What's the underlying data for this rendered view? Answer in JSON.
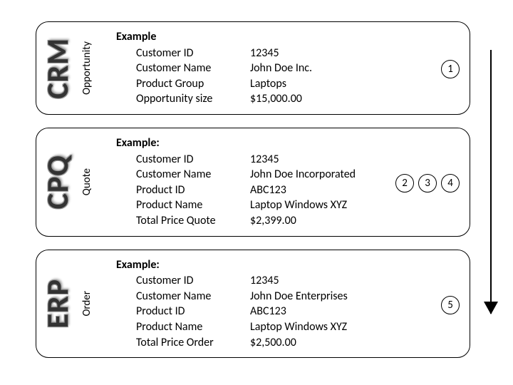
{
  "cards": [
    {
      "system": "CRM",
      "stage": "Opportunity",
      "heading": "Example",
      "colon": "",
      "badges": [
        "1"
      ],
      "rows": [
        {
          "key": "Customer ID",
          "val": "12345"
        },
        {
          "key": "Customer Name",
          "val": "John Doe Inc."
        },
        {
          "key": "Product Group",
          "val": "Laptops"
        },
        {
          "key": "Opportunity size",
          "val": "$15,000.00"
        }
      ]
    },
    {
      "system": "CPQ",
      "stage": "Quote",
      "heading": "Example",
      "colon": ":",
      "badges": [
        "2",
        "3",
        "4"
      ],
      "rows": [
        {
          "key": "Customer ID",
          "val": "12345"
        },
        {
          "key": "Customer Name",
          "val": "John Doe Incorporated"
        },
        {
          "key": "Product ID",
          "val": "ABC123"
        },
        {
          "key": "Product Name",
          "val": "Laptop Windows XYZ"
        },
        {
          "key": "Total Price Quote",
          "val": "$2,399.00"
        }
      ]
    },
    {
      "system": "ERP",
      "stage": "Order",
      "heading": "Example",
      "colon": ":",
      "badges": [
        "5"
      ],
      "rows": [
        {
          "key": "Customer ID",
          "val": "12345"
        },
        {
          "key": "Customer Name",
          "val": "John Doe Enterprises"
        },
        {
          "key": "Product ID",
          "val": "ABC123"
        },
        {
          "key": "Product Name",
          "val": "Laptop Windows XYZ"
        },
        {
          "key": "Total Price Order",
          "val": "$2,500.00"
        }
      ]
    }
  ]
}
